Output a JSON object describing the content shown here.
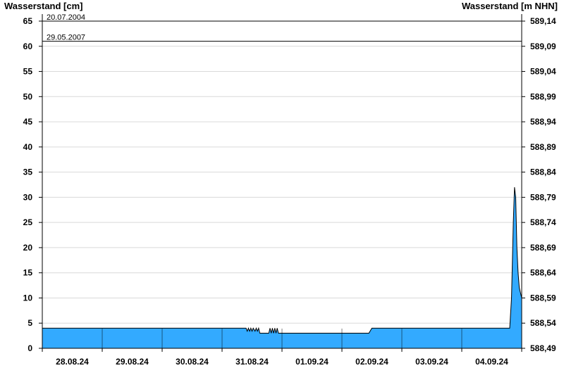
{
  "chart_data": {
    "type": "area",
    "ylabel_left": "Wasserstand [cm]",
    "ylabel_right": "Wasserstand [m NHN]",
    "ylim": [
      0,
      65
    ],
    "yticks_left": [
      0,
      5,
      10,
      15,
      20,
      25,
      30,
      35,
      40,
      45,
      50,
      55,
      60,
      65
    ],
    "yticks_right": [
      "588,49",
      "588,54",
      "588,59",
      "588,64",
      "588,69",
      "588,74",
      "588,79",
      "588,84",
      "588,89",
      "588,94",
      "588,99",
      "589,04",
      "589,09",
      "589,14"
    ],
    "xlim_days": [
      0,
      8
    ],
    "xticks": [
      "28.08.24",
      "29.08.24",
      "30.08.24",
      "31.08.24",
      "01.09.24",
      "02.09.24",
      "03.09.24",
      "04.09.24"
    ],
    "grid": true,
    "fill_color": "#33aaff",
    "reference_lines": [
      {
        "label": "20.07.2004",
        "value": 65
      },
      {
        "label": "29.05.2007",
        "value": 61
      }
    ],
    "series": [
      {
        "values": [
          [
            0,
            4
          ],
          [
            3.4,
            4
          ],
          [
            3.42,
            3.4
          ],
          [
            3.44,
            4
          ],
          [
            3.46,
            3.4
          ],
          [
            3.48,
            4
          ],
          [
            3.5,
            3.4
          ],
          [
            3.52,
            4
          ],
          [
            3.55,
            3.4
          ],
          [
            3.57,
            4
          ],
          [
            3.59,
            3.4
          ],
          [
            3.61,
            4
          ],
          [
            3.63,
            3
          ],
          [
            3.78,
            3
          ],
          [
            3.8,
            4
          ],
          [
            3.82,
            3
          ],
          [
            3.84,
            4
          ],
          [
            3.86,
            3
          ],
          [
            3.88,
            4
          ],
          [
            3.9,
            3
          ],
          [
            3.92,
            4
          ],
          [
            3.94,
            3
          ],
          [
            4.0,
            3
          ],
          [
            4.8,
            3
          ],
          [
            5.45,
            3
          ],
          [
            5.5,
            4
          ],
          [
            7.8,
            4
          ],
          [
            7.83,
            10
          ],
          [
            7.86,
            25
          ],
          [
            7.88,
            32
          ],
          [
            7.9,
            30
          ],
          [
            7.92,
            20
          ],
          [
            7.94,
            15
          ],
          [
            7.96,
            12
          ],
          [
            7.98,
            11
          ],
          [
            8.0,
            10
          ]
        ]
      }
    ]
  }
}
